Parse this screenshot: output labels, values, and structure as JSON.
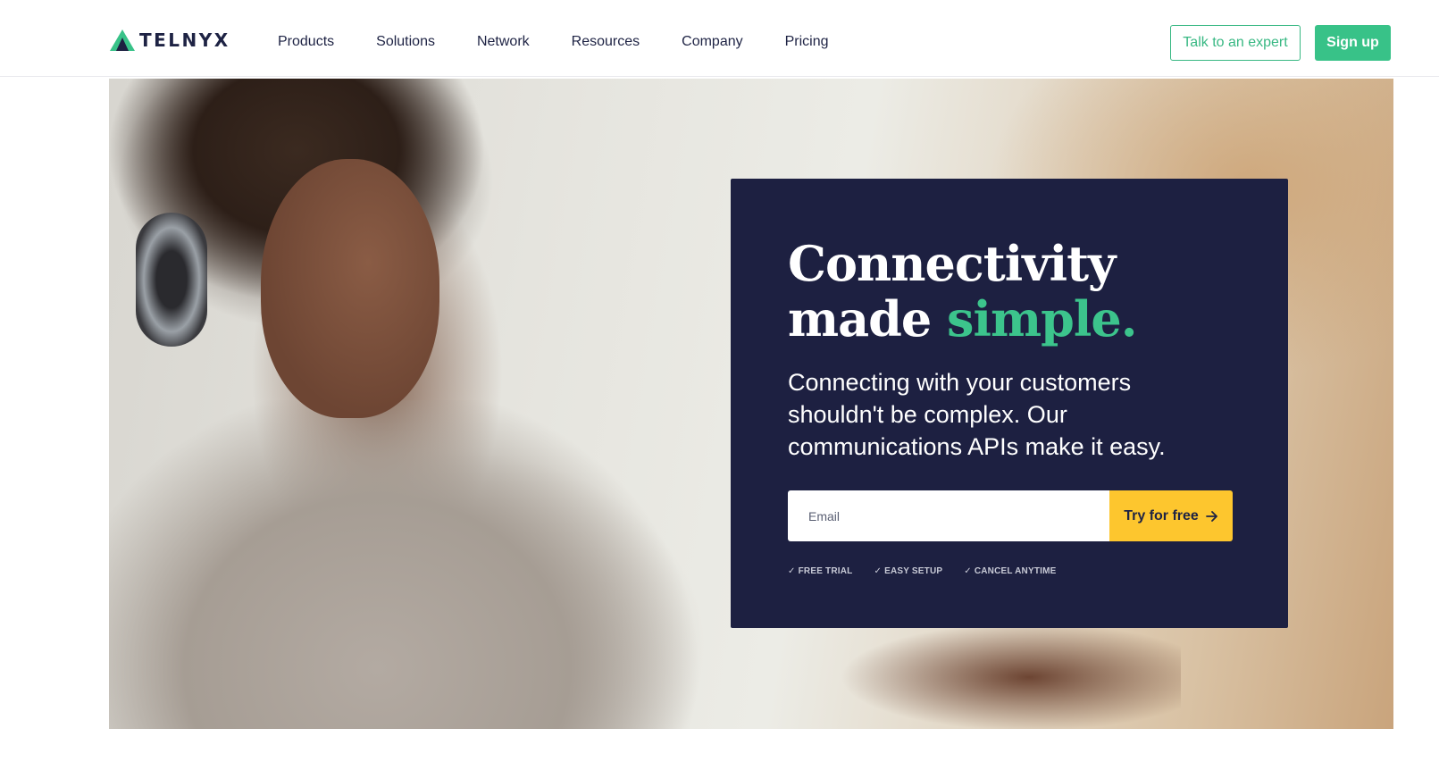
{
  "brand": {
    "name": "TELNYX",
    "accent": "#38c288",
    "navy": "#1d2041",
    "yellow": "#fdc62e"
  },
  "nav": {
    "items": [
      {
        "label": "Products"
      },
      {
        "label": "Solutions"
      },
      {
        "label": "Network"
      },
      {
        "label": "Resources"
      },
      {
        "label": "Company"
      },
      {
        "label": "Pricing"
      }
    ]
  },
  "header": {
    "expert_label": "Talk to an expert",
    "signup_label": "Sign up"
  },
  "hero": {
    "headline_line1": "Connectivity",
    "headline_line2_start": "made ",
    "headline_line2_accent": "simple.",
    "subtext": "Connecting with your customers shouldn't be complex. Our communications APIs make it easy.",
    "email_placeholder": "Email",
    "cta_label": "Try for free",
    "cta_icon": "arrow-right-icon",
    "features": [
      {
        "label": "FREE TRIAL",
        "icon": "check-icon"
      },
      {
        "label": "EASY SETUP",
        "icon": "check-icon"
      },
      {
        "label": "CANCEL ANYTIME",
        "icon": "check-icon"
      }
    ]
  }
}
